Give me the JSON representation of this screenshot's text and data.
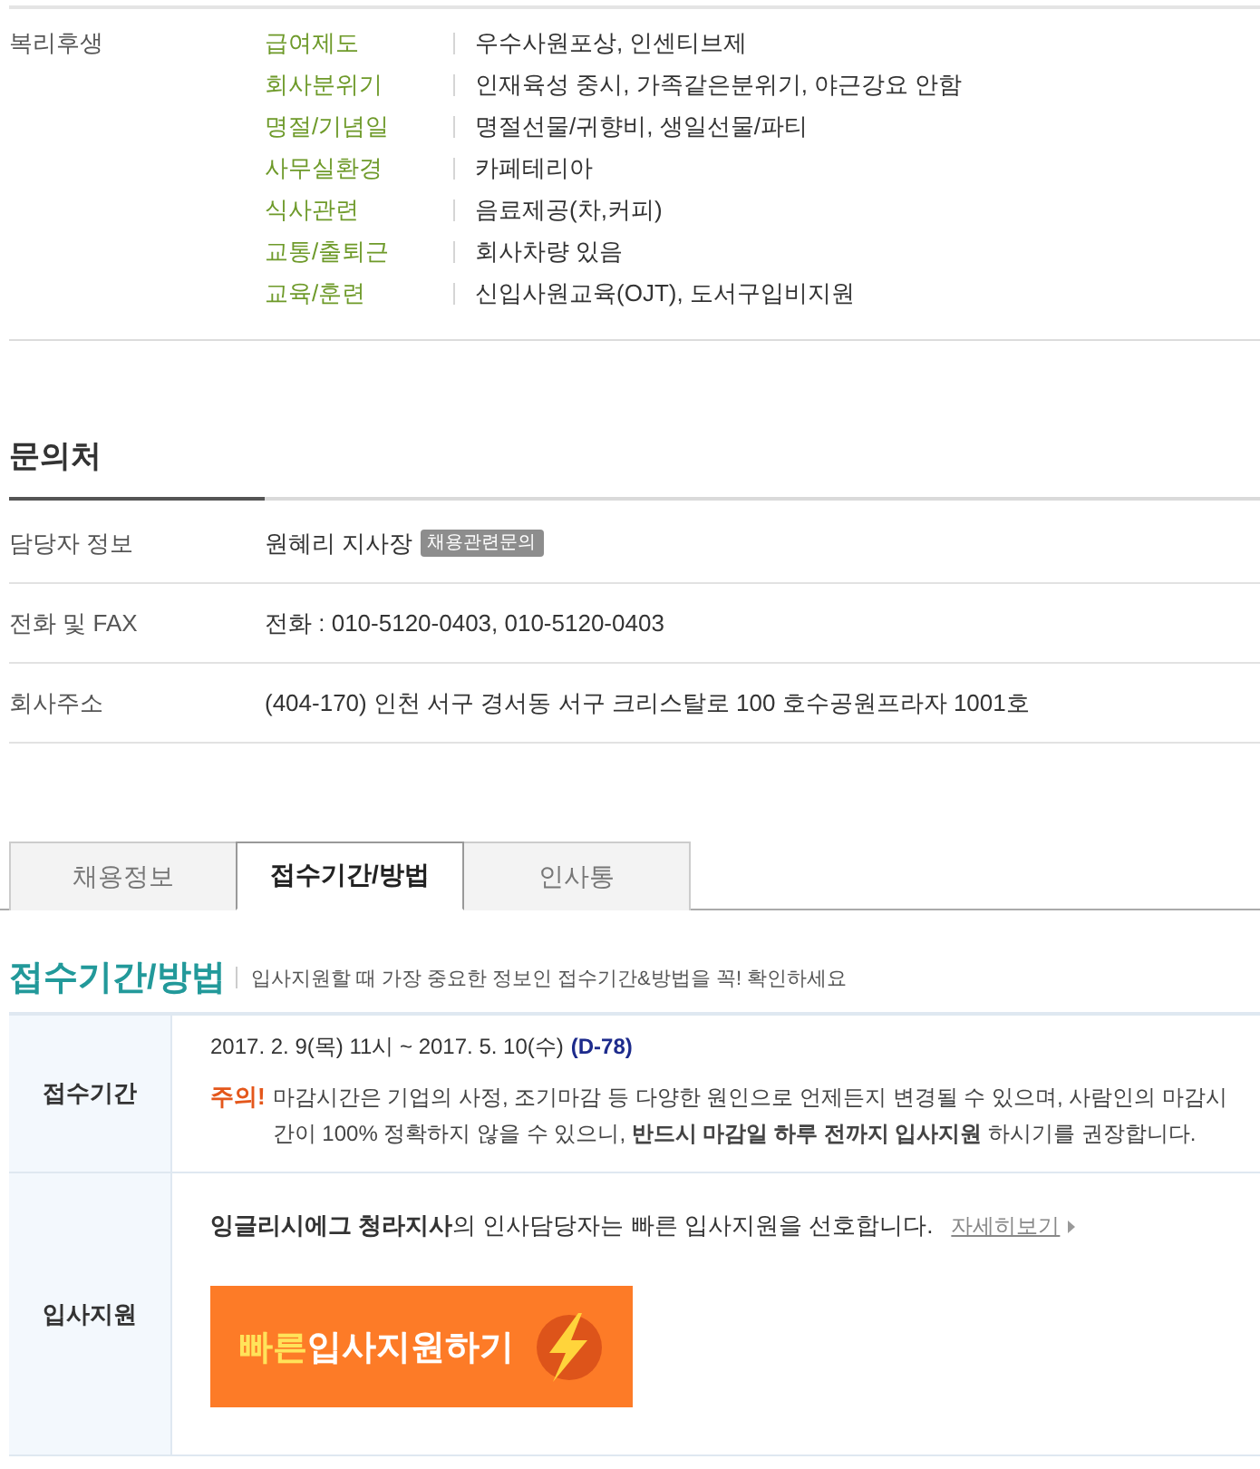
{
  "benefits": {
    "title": "복리후생",
    "items": [
      {
        "label": "급여제도",
        "value": "우수사원포상, 인센티브제"
      },
      {
        "label": "회사분위기",
        "value": "인재육성 중시, 가족같은분위기, 야근강요 안함"
      },
      {
        "label": "명절/기념일",
        "value": "명절선물/귀향비, 생일선물/파티"
      },
      {
        "label": "사무실환경",
        "value": "카페테리아"
      },
      {
        "label": "식사관련",
        "value": "음료제공(차,커피)"
      },
      {
        "label": "교통/출퇴근",
        "value": "회사차량 있음"
      },
      {
        "label": "교육/훈련",
        "value": "신입사원교육(OJT), 도서구입비지원"
      }
    ]
  },
  "contact": {
    "title": "문의처",
    "rows": [
      {
        "label": "담당자 정보",
        "value": "원혜리 지사장",
        "tag": "채용관련문의"
      },
      {
        "label": "전화 및 FAX",
        "value": "전화 : 010-5120-0403, 010-5120-0403"
      },
      {
        "label": "회사주소",
        "value": "(404-170) 인천 서구 경서동 서구 크리스탈로 100 호수공원프라자 1001호"
      }
    ]
  },
  "tabs": [
    {
      "label": "채용정보",
      "selected": false
    },
    {
      "label": "접수기간/방법",
      "selected": true
    },
    {
      "label": "인사통",
      "selected": false
    }
  ],
  "apply_section": {
    "title": "접수기간/방법",
    "subtitle": "입사지원할 때 가장 중요한 정보인 접수기간&방법을 꼭! 확인하세요",
    "period": {
      "label": "접수기간",
      "dates": "2017. 2. 9(목) 11시 ~ 2017. 5. 10(수)",
      "dday": "(D-78)",
      "notice_label": "주의!",
      "notice": "마감시간은 기업의 사정, 조기마감 등 다양한 원인으로 언제든지 변경될 수 있으며, 사람인의 마감시간이 100% 정확하지 않을 수 있으니, **반드시 마감일 하루 전까지 입사지원** 하시기를 권장합니다."
    },
    "method": {
      "label": "입사지원",
      "message": "**잉글리시에그 청라지사**의 인사담당자는 빠른 입사지원을 선호합니다.",
      "link": "자세히보기",
      "button": {
        "highlight": "빠른",
        "label": "입사지원하기"
      }
    }
  }
}
